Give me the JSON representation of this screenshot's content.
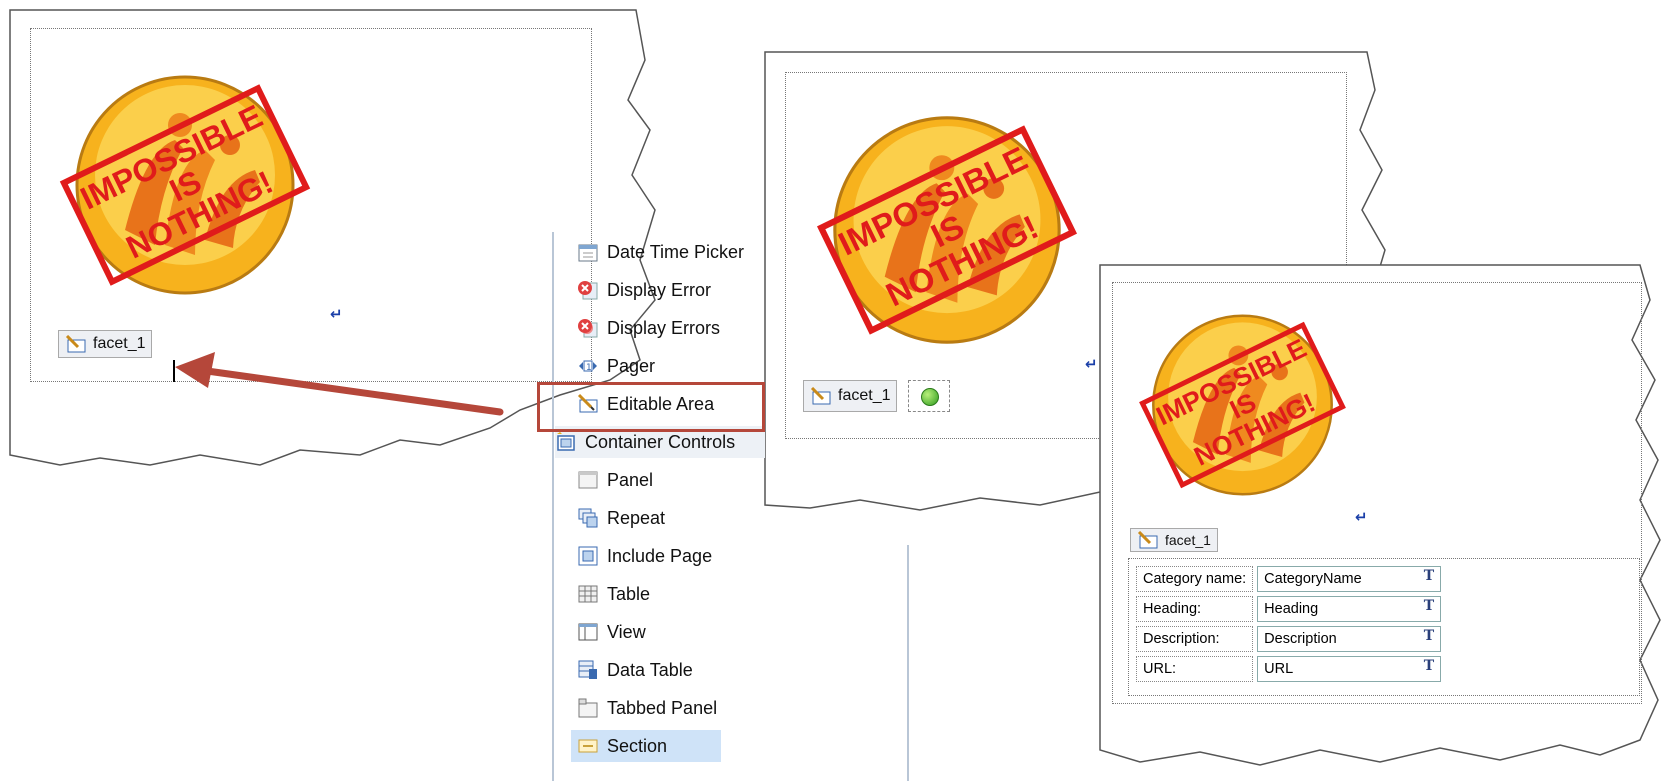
{
  "stamp": {
    "line1": "IMPOSSIBLE",
    "line2": "IS",
    "line3": "NOTHING!"
  },
  "facet_label": "facet_1",
  "palette": {
    "items": [
      {
        "label": "Date Time Picker",
        "icon": "date-time-picker-icon"
      },
      {
        "label": "Display Error",
        "icon": "display-error-icon"
      },
      {
        "label": "Display Errors",
        "icon": "display-errors-icon"
      },
      {
        "label": "Pager",
        "icon": "pager-icon"
      },
      {
        "label": "Editable Area",
        "icon": "editable-area-icon"
      },
      {
        "label": "Container Controls",
        "icon": "container-controls-icon"
      },
      {
        "label": "Panel",
        "icon": "panel-icon"
      },
      {
        "label": "Repeat",
        "icon": "repeat-icon"
      },
      {
        "label": "Include Page",
        "icon": "include-page-icon"
      },
      {
        "label": "Table",
        "icon": "table-icon"
      },
      {
        "label": "View",
        "icon": "view-icon"
      },
      {
        "label": "Data Table",
        "icon": "data-table-icon"
      },
      {
        "label": "Tabbed Panel",
        "icon": "tabbed-panel-icon"
      },
      {
        "label": "Section",
        "icon": "section-icon"
      }
    ],
    "highlighted": "Editable Area",
    "selected": "Section"
  },
  "form_fields": [
    {
      "label": "Category name:",
      "value": "CategoryName"
    },
    {
      "label": "Heading:",
      "value": "Heading"
    },
    {
      "label": "Description:",
      "value": "Description"
    },
    {
      "label": "URL:",
      "value": "URL"
    }
  ],
  "colors": {
    "highlight_box": "#b5473a",
    "arrow": "#b5473a",
    "stamp": "#e01b1b",
    "logo_orange": "#f39a1c"
  }
}
